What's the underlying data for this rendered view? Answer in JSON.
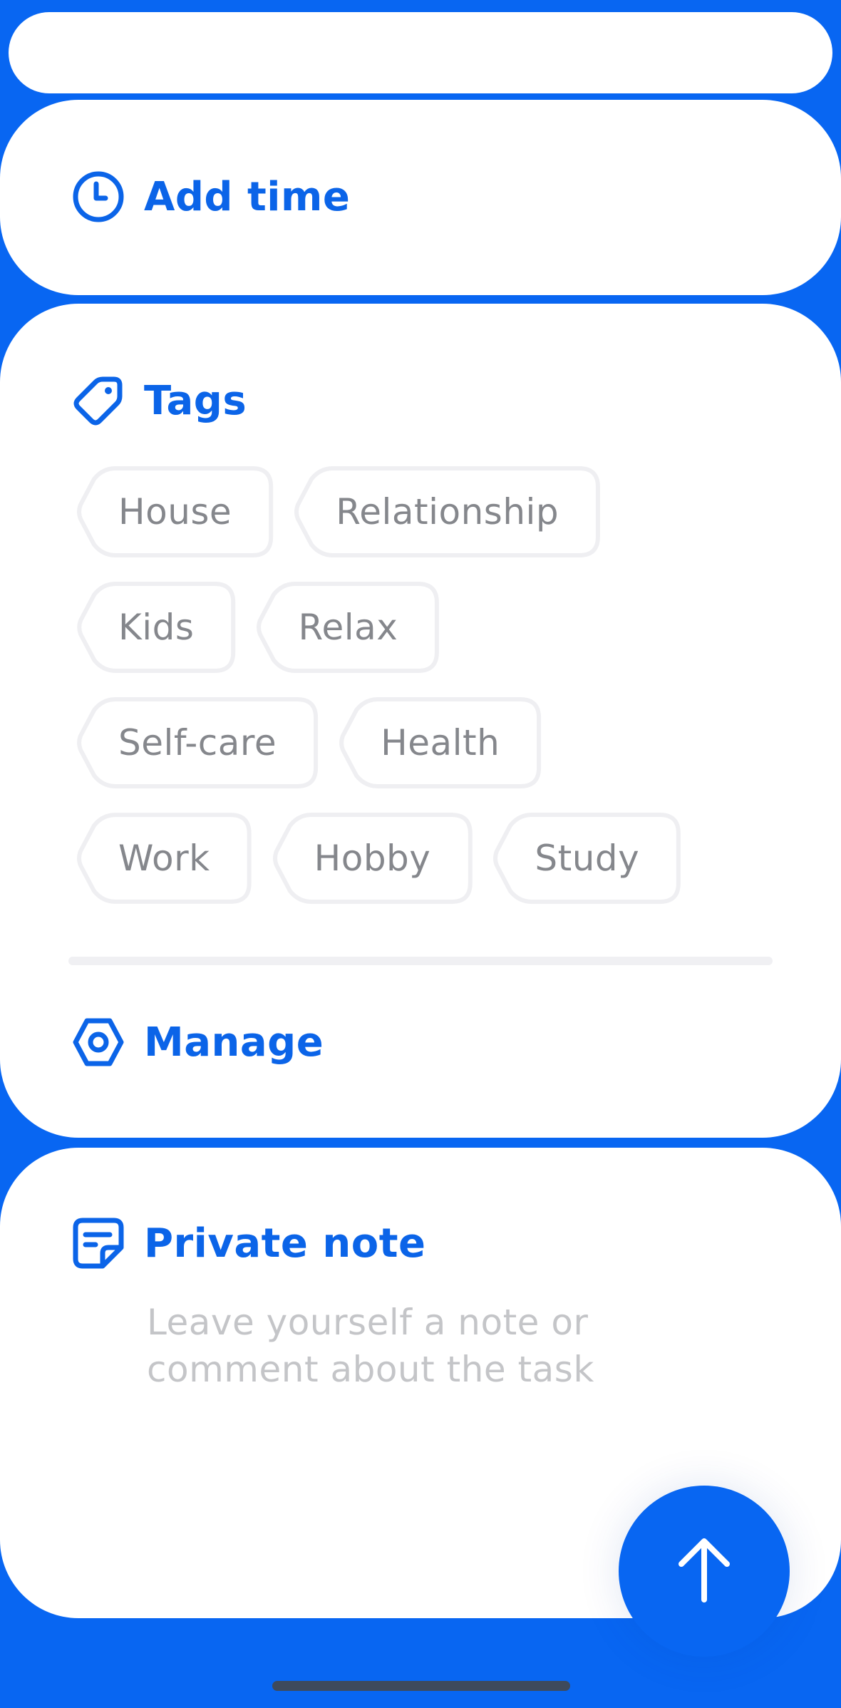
{
  "time_section": {
    "icon": "clock-icon",
    "label": "Add time"
  },
  "tags_section": {
    "icon": "tag-icon",
    "title": "Tags",
    "rows": [
      [
        "House",
        "Relationship"
      ],
      [
        "Kids",
        "Relax"
      ],
      [
        "Self-care",
        "Health"
      ],
      [
        "Work",
        "Hobby",
        "Study"
      ]
    ],
    "manage": {
      "icon": "settings-icon",
      "label": "Manage"
    }
  },
  "note_section": {
    "icon": "note-icon",
    "title": "Private note",
    "placeholder": "Leave yourself a note or comment about the task"
  },
  "submit_button": {
    "icon": "arrow-up-icon"
  },
  "colors": {
    "accent": "#0866f2",
    "accent_text": "#0b64e8",
    "tag_text": "#85878c",
    "tag_border": "#efeff2",
    "placeholder": "#c4c5c8",
    "card": "#ffffff"
  }
}
